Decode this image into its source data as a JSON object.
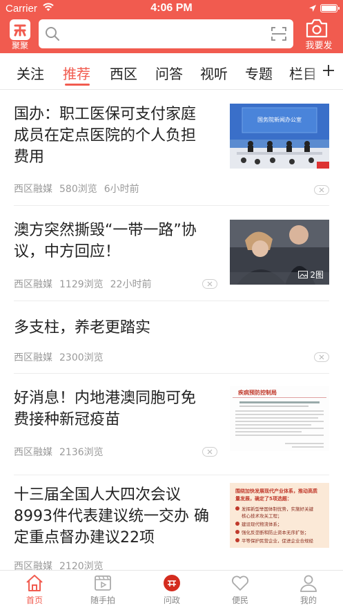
{
  "status_bar": {
    "carrier": "Carrier",
    "time": "4:06 PM"
  },
  "header": {
    "logo_label": "聚聚",
    "search_placeholder": "",
    "camera_label": "我要发"
  },
  "tabs": [
    {
      "label": "关注"
    },
    {
      "label": "推荐",
      "active": true
    },
    {
      "label": "西区"
    },
    {
      "label": "问答"
    },
    {
      "label": "视听"
    },
    {
      "label": "专题"
    },
    {
      "label": "栏目"
    }
  ],
  "articles": [
    {
      "title": "国办：职工医保可支付家庭成员在定点医院的个人负担费用",
      "source": "西区融媒",
      "views": "580浏览",
      "time": "6小时前"
    },
    {
      "title": "澳方突然撕毁“一带一路”协议，中方回应！",
      "source": "西区融媒",
      "views": "1129浏览",
      "time": "22小时前",
      "image_count": "2图"
    },
    {
      "title": "多支柱，养老更踏实",
      "source": "西区融媒",
      "views": "2300浏览"
    },
    {
      "title": "好消息！内地港澳同胞可免费接种新冠疫苗",
      "source": "西区融媒",
      "views": "2136浏览"
    },
    {
      "title": "十三届全国人大四次会议8993件代表建议统一交办 确定重点督办建议22项",
      "source": "西区融媒",
      "views": "2120浏览"
    }
  ],
  "thumbs": {
    "a1_banner": "国务院新闻办公室",
    "a4_header": "疾病预防控制局",
    "a5_line1": "围绕加快发展现代产业体系，推动高质",
    "a5_line2": "量发展，确定了5项选题：",
    "a5_item1": "发挥新型举国体制优势，实施好关键",
    "a5_item1b": "核心技术攻关工程；",
    "a5_item2": "建设现代物流体系；",
    "a5_item3": "强化反垄断和防止资本无序扩张；",
    "a5_item4": "平等保护民营企业，促进企业合规经"
  },
  "bottom_nav": [
    {
      "label": "首页",
      "active": true,
      "icon": "home-icon"
    },
    {
      "label": "随手拍",
      "icon": "video-icon"
    },
    {
      "label": "问政",
      "icon": "wenzheng-icon"
    },
    {
      "label": "便民",
      "icon": "heart-icon"
    },
    {
      "label": "我的",
      "icon": "user-icon"
    }
  ],
  "colors": {
    "brand": "#f15b4f",
    "text": "#222222",
    "meta": "#9a9a9a"
  }
}
